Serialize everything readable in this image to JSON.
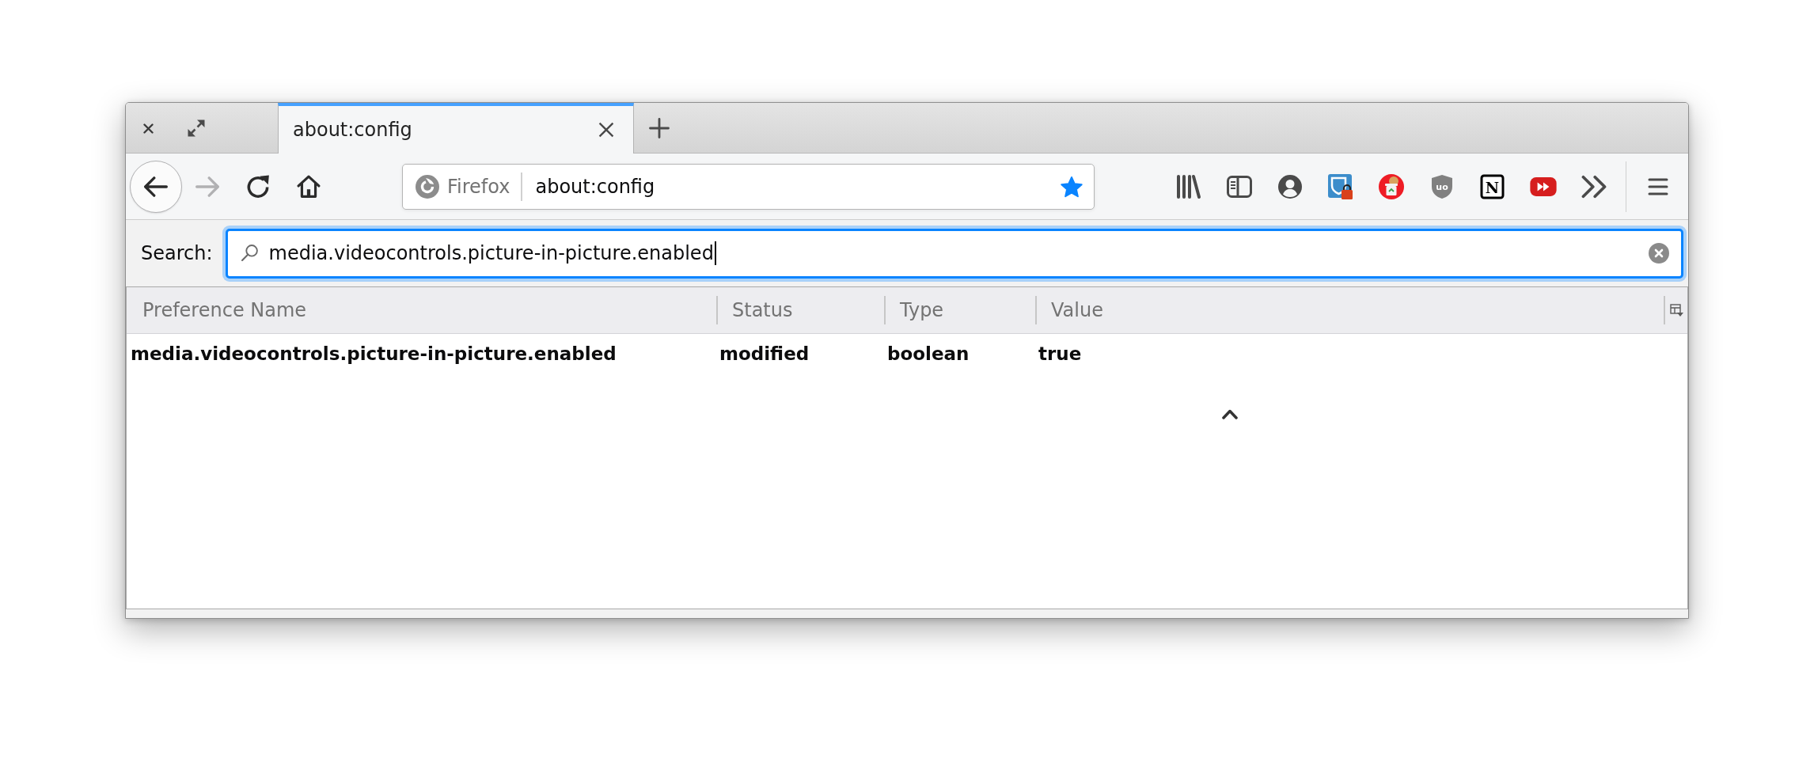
{
  "tabs": [
    {
      "title": "about:config",
      "selected": true
    }
  ],
  "nav_buttons": [
    {
      "kind": "back",
      "disabled": false
    },
    {
      "kind": "forward",
      "disabled": true
    },
    {
      "kind": "reload",
      "disabled": false
    },
    {
      "kind": "home",
      "disabled": false
    }
  ],
  "url_bar": {
    "identity": "Firefox",
    "url": "about:config",
    "bookmarked": true
  },
  "toolbar": [
    {
      "kind": "library"
    },
    {
      "kind": "sidebar"
    },
    {
      "kind": "account"
    },
    {
      "kind": "vault"
    },
    {
      "kind": "cookie"
    },
    {
      "kind": "shield",
      "glyph": "uo"
    },
    {
      "kind": "tile",
      "glyph": "N"
    },
    {
      "kind": "fast_forward"
    },
    {
      "kind": "overflow"
    }
  ],
  "search": {
    "label": "Search:",
    "value": "media.videocontrols.picture-in-picture.enabled",
    "focused": true
  },
  "table": {
    "columns": [
      "Preference Name",
      "Status",
      "Type",
      "Value"
    ],
    "rows": [
      {
        "cells": [
          "media.videocontrols.picture-in-picture.enabled",
          "modified",
          "boolean",
          "true"
        ],
        "modified": true
      }
    ]
  }
}
